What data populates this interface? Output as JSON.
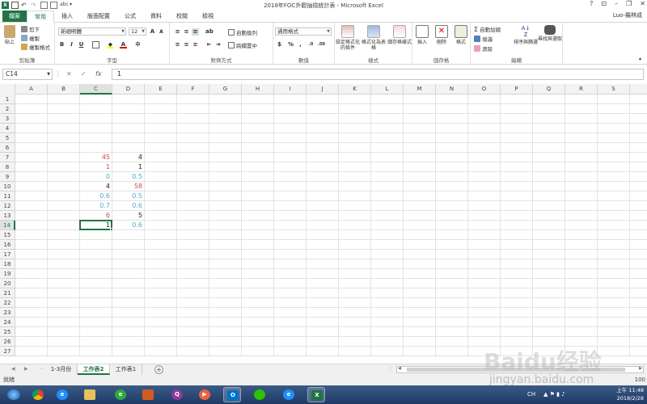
{
  "window": {
    "title": "2018年FOC外觀抽檢統計表 - Microsoft Excel",
    "user": "Luo-羅林成",
    "controls": [
      "?",
      "⊡",
      "–",
      "❐",
      "✕"
    ]
  },
  "ribbon_tabs": [
    "檔案",
    "常用",
    "插入",
    "版面配置",
    "公式",
    "資料",
    "校閱",
    "檢視"
  ],
  "ribbon": {
    "clipboard": {
      "paste": "貼上",
      "cut": "剪下",
      "copy": "複製",
      "format_painter": "複製格式",
      "label": "剪貼簿"
    },
    "font": {
      "name": "新細明體",
      "size": "12",
      "label": "字型",
      "bold": "B",
      "italic": "I",
      "underline": "U",
      "grow": "A",
      "shrink": "A"
    },
    "alignment": {
      "wrap": "自動換列",
      "merge": "跨欄置中",
      "label": "對齊方式"
    },
    "number": {
      "format": "通用格式",
      "currency": "$",
      "percent": "%",
      "comma": ",",
      "label": "數值"
    },
    "styles": {
      "conditional": "設定格式化的條件",
      "as_table": "格式化為表格",
      "cell_styles": "儲存格樣式",
      "label": "樣式"
    },
    "cells": {
      "insert": "插入",
      "delete": "刪除",
      "format": "格式",
      "label": "儲存格"
    },
    "editing": {
      "autosum": "自動加總",
      "fill": "填滿",
      "clear": "清除",
      "sort_filter": "排序與篩選",
      "find_select": "尋找與選取",
      "label": "編輯"
    }
  },
  "formula_bar": {
    "name_box": "C14",
    "formula_value": "1",
    "fx": "fx"
  },
  "columns": [
    "A",
    "B",
    "C",
    "D",
    "E",
    "F",
    "G",
    "H",
    "I",
    "J",
    "K",
    "L",
    "M",
    "N",
    "O",
    "P",
    "Q",
    "R",
    "S"
  ],
  "rows": [
    "1",
    "2",
    "3",
    "4",
    "5",
    "6",
    "7",
    "8",
    "9",
    "10",
    "11",
    "12",
    "13",
    "14",
    "15",
    "16",
    "17",
    "18",
    "19",
    "20",
    "21",
    "22",
    "23",
    "24",
    "25",
    "26",
    "27"
  ],
  "selected": {
    "column": "C",
    "row": "14"
  },
  "cells": [
    {
      "col": "C",
      "row": 7,
      "value": "45",
      "color": "#c0504d"
    },
    {
      "col": "D",
      "row": 7,
      "value": "4",
      "color": "#222222"
    },
    {
      "col": "C",
      "row": 8,
      "value": "1",
      "color": "#c0504d"
    },
    {
      "col": "D",
      "row": 8,
      "value": "1",
      "color": "#222222"
    },
    {
      "col": "C",
      "row": 9,
      "value": "0",
      "color": "#4bacc6"
    },
    {
      "col": "D",
      "row": 9,
      "value": "0.5",
      "color": "#4bacc6"
    },
    {
      "col": "C",
      "row": 10,
      "value": "4",
      "color": "#222222"
    },
    {
      "col": "D",
      "row": 10,
      "value": "58",
      "color": "#c0504d"
    },
    {
      "col": "C",
      "row": 11,
      "value": "0.6",
      "color": "#4bacc6"
    },
    {
      "col": "D",
      "row": 11,
      "value": "0.5",
      "color": "#4bacc6"
    },
    {
      "col": "C",
      "row": 12,
      "value": "0.7",
      "color": "#4bacc6"
    },
    {
      "col": "D",
      "row": 12,
      "value": "0.6",
      "color": "#4bacc6"
    },
    {
      "col": "C",
      "row": 13,
      "value": "6",
      "color": "#c0504d"
    },
    {
      "col": "D",
      "row": 13,
      "value": "5",
      "color": "#222222"
    },
    {
      "col": "C",
      "row": 14,
      "value": "1",
      "color": "#222222"
    },
    {
      "col": "D",
      "row": 14,
      "value": "0.6",
      "color": "#4bacc6"
    }
  ],
  "sheet_tabs": [
    {
      "label": "1-3月份",
      "active": false
    },
    {
      "label": "工作表2",
      "active": true
    },
    {
      "label": "工作表1",
      "active": false
    }
  ],
  "status": {
    "text": "就緒",
    "zoom": "100"
  },
  "taskbar": {
    "clock_time": "上午 11:48",
    "clock_date": "2018/2/28",
    "lang": "CH"
  },
  "watermark": {
    "brand": "Baidu经验",
    "url": "jingyan.baidu.com"
  },
  "colors": {
    "excel_green": "#217346",
    "red_text": "#c0504d",
    "blue_text": "#4bacc6"
  }
}
